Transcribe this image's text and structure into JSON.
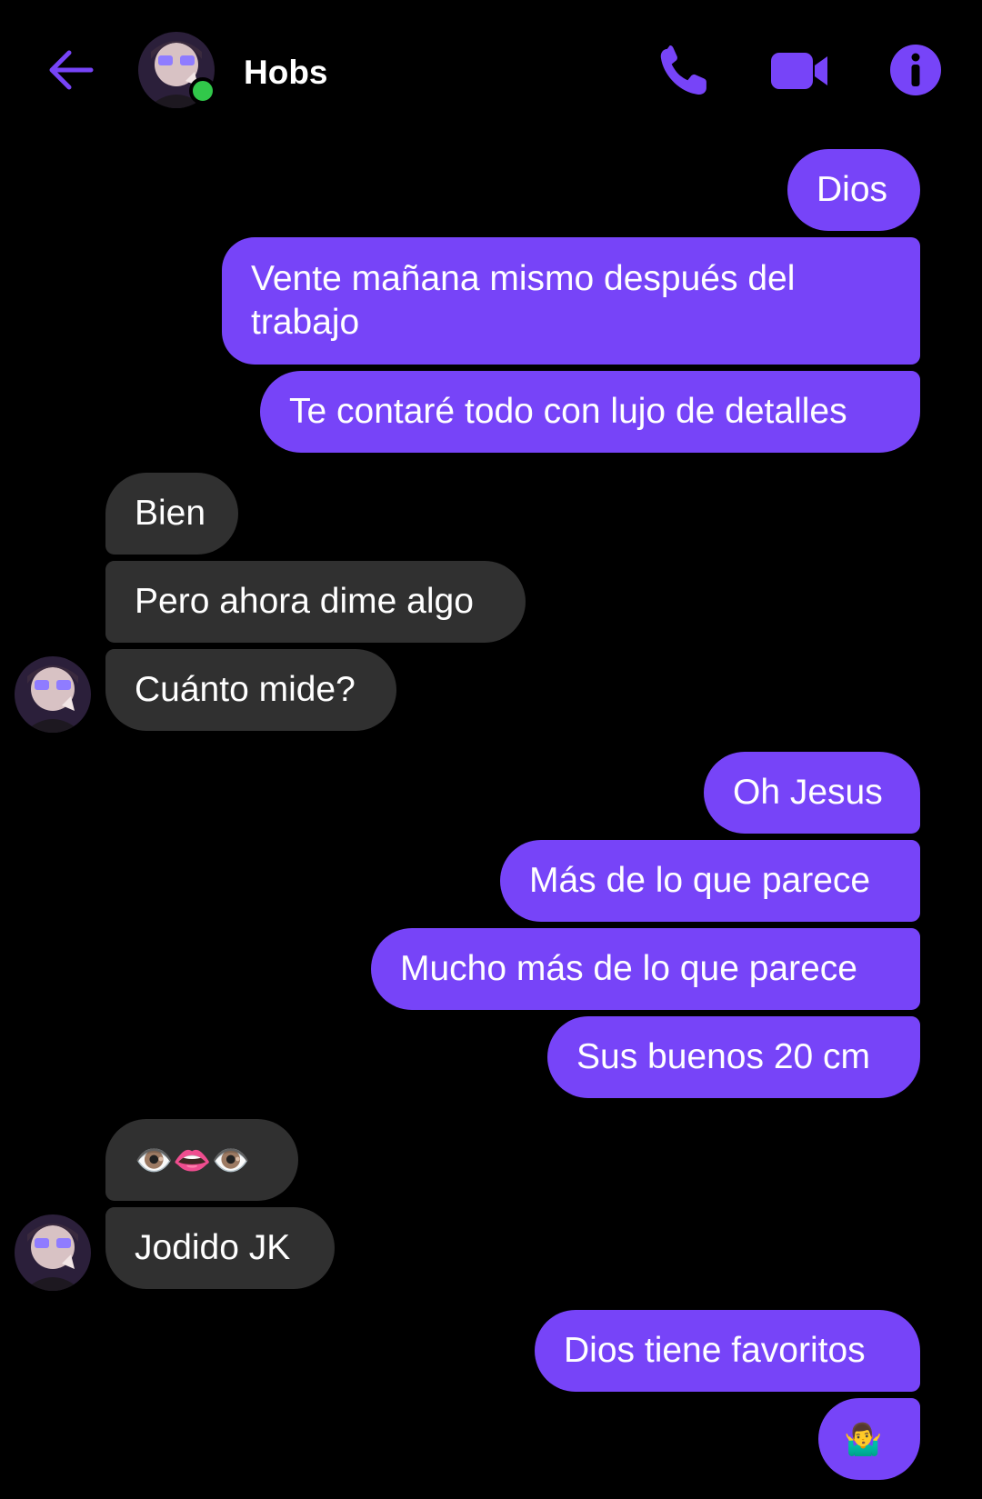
{
  "header": {
    "contact_name": "Hobs",
    "status": "online",
    "icons": [
      "back-arrow-icon",
      "phone-icon",
      "video-camera-icon",
      "info-icon"
    ],
    "accent_color": "#7744f8"
  },
  "messages": [
    {
      "side": "out",
      "text": "Dios"
    },
    {
      "side": "out",
      "text": "Vente mañana mismo después del\ntrabajo"
    },
    {
      "side": "out",
      "text": "Te contaré todo con lujo de detalles"
    },
    {
      "side": "in",
      "text": "Bien"
    },
    {
      "side": "in",
      "text": "Pero ahora dime algo"
    },
    {
      "side": "in",
      "text": "Cuánto mide?"
    },
    {
      "side": "out",
      "text": "Oh Jesus"
    },
    {
      "side": "out",
      "text": "Más de lo que parece"
    },
    {
      "side": "out",
      "text": "Mucho más de lo que parece"
    },
    {
      "side": "out",
      "text": "Sus buenos 20 cm"
    },
    {
      "side": "in",
      "text": "👁️👄👁️"
    },
    {
      "side": "in",
      "text": "Jodido JK"
    },
    {
      "side": "out",
      "text": "Dios tiene favoritos"
    },
    {
      "side": "out",
      "text": "🤷‍♂️"
    }
  ],
  "colors": {
    "outgoing_bubble": "#7744f8",
    "incoming_bubble": "#303030",
    "background": "#000000",
    "online_indicator": "#31c84a"
  }
}
